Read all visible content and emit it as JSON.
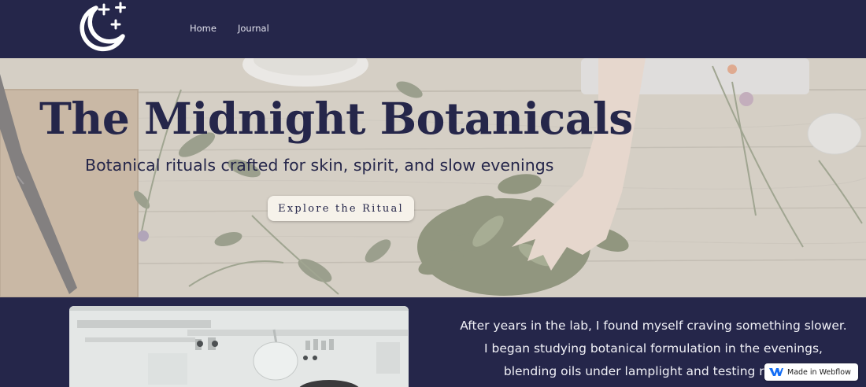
{
  "nav": {
    "logo_icon": "moon-stars-icon",
    "links": [
      {
        "label": "Home"
      },
      {
        "label": "Journal"
      }
    ]
  },
  "hero": {
    "title": "The Midnight Botanicals",
    "subtitle": "Botanical rituals crafted for skin, spirit, and slow evenings",
    "cta_label": "Explore the Ritual"
  },
  "about": {
    "photo": "laboratory-photo",
    "lines": [
      "After years in the lab, I found myself craving something slower.",
      "I began studying botanical formulation in the evenings,",
      "blending oils under lamplight and testing recipes"
    ]
  },
  "badge": {
    "label": "Made in Webflow",
    "icon": "webflow-icon"
  },
  "colors": {
    "navy": "#25264a",
    "cream": "#f6f2ea",
    "text_light": "#f0f0f6"
  }
}
